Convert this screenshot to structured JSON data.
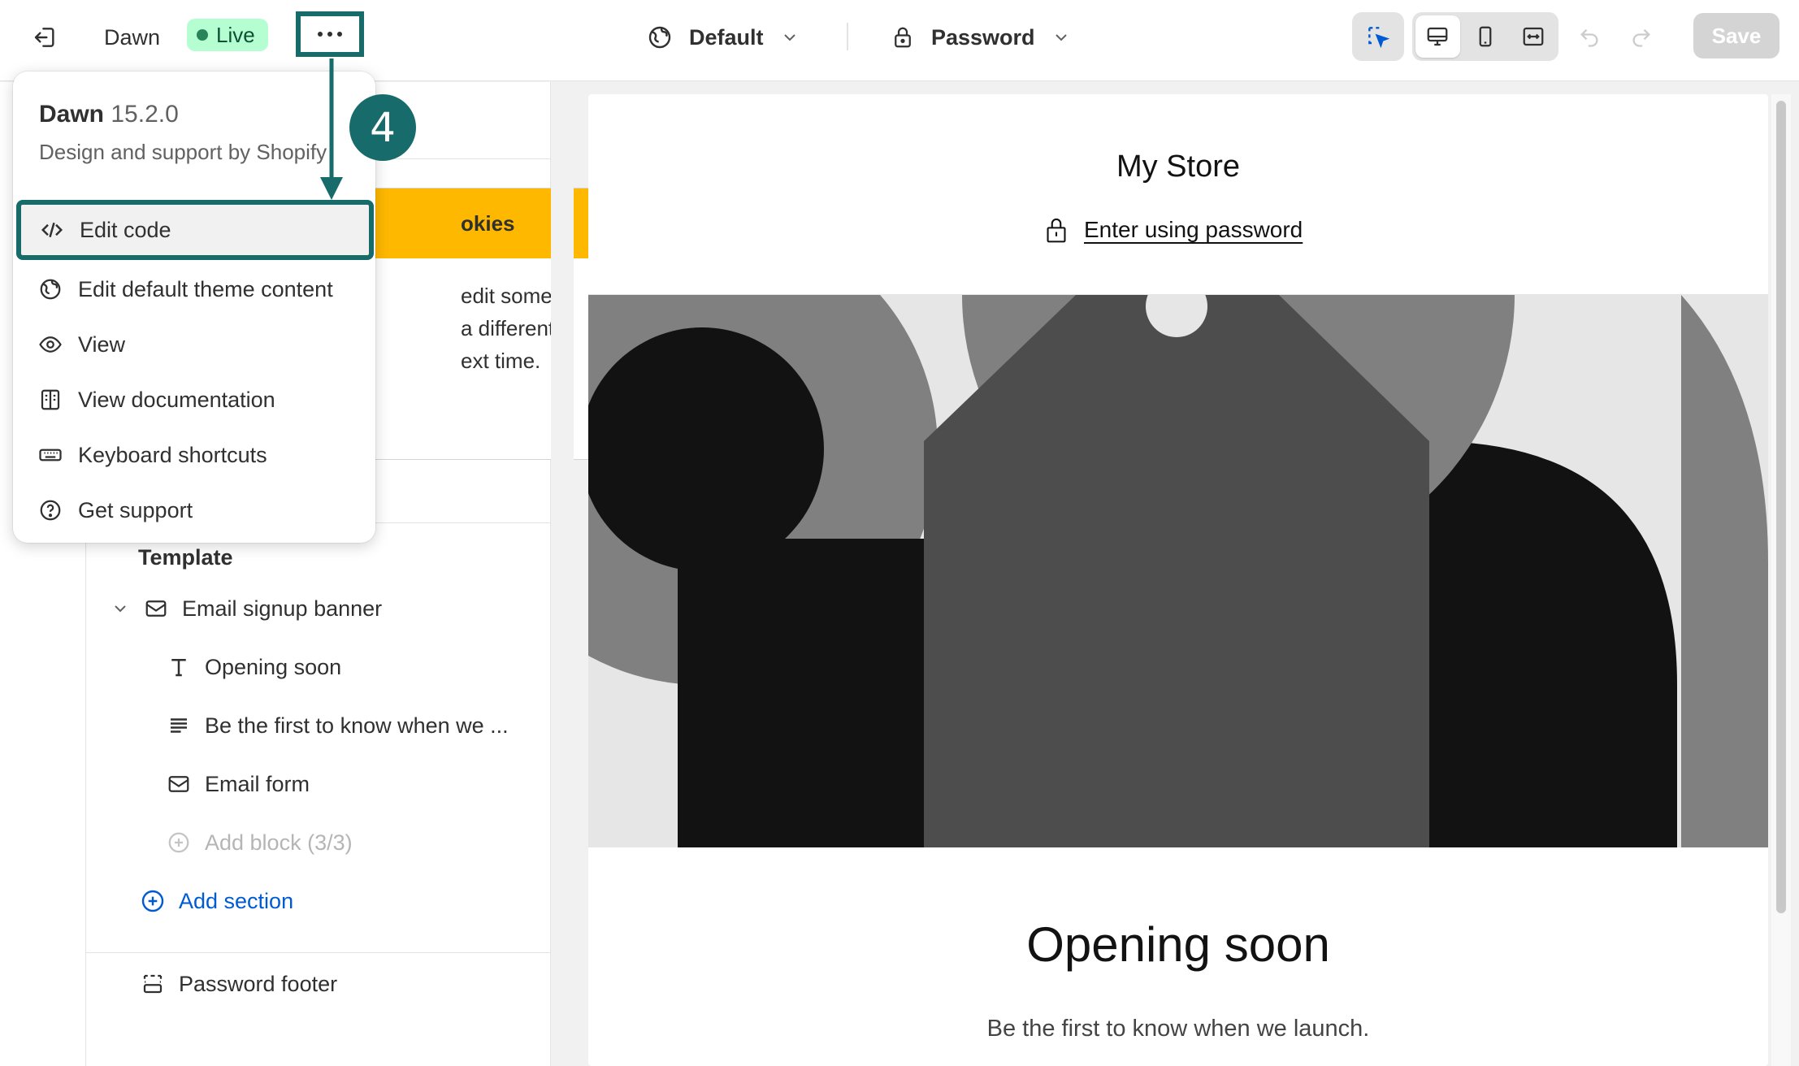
{
  "topbar": {
    "theme_name": "Dawn",
    "status_badge": "Live",
    "template_selector": "Default",
    "page_selector": "Password",
    "save_label": "Save"
  },
  "menu": {
    "theme_name": "Dawn",
    "version": "15.2.0",
    "subtitle": "Design and support by Shopify",
    "items": [
      {
        "label": "Edit code",
        "icon": "code-icon"
      },
      {
        "label": "Edit default theme content",
        "icon": "globe-icon"
      },
      {
        "label": "View",
        "icon": "eye-icon"
      },
      {
        "label": "View documentation",
        "icon": "book-icon"
      },
      {
        "label": "Keyboard shortcuts",
        "icon": "keyboard-icon"
      },
      {
        "label": "Get support",
        "icon": "question-circle-icon"
      }
    ]
  },
  "sidebar": {
    "cookie_card": {
      "title_partial": "okies",
      "body_lines": [
        "edit some",
        "a different",
        "ext time."
      ]
    },
    "section_heading": "Template",
    "section_name": "Email signup banner",
    "blocks": [
      {
        "label": "Opening soon",
        "icon": "text-icon"
      },
      {
        "label": "Be the first to know when we ...",
        "icon": "paragraph-icon"
      },
      {
        "label": "Email form",
        "icon": "email-icon"
      }
    ],
    "add_block": "Add block (3/3)",
    "add_section": "Add section",
    "footer_section": "Password footer"
  },
  "preview": {
    "store_name": "My Store",
    "password_link": "Enter using password",
    "heading": "Opening soon",
    "subheading": "Be the first to know when we launch."
  },
  "annotation": {
    "step_number": "4",
    "accent_color": "#176b6b"
  },
  "colors": {
    "live_badge_bg": "#b4fed2",
    "cookie_banner": "#ffb800",
    "link_blue": "#005bd3"
  }
}
